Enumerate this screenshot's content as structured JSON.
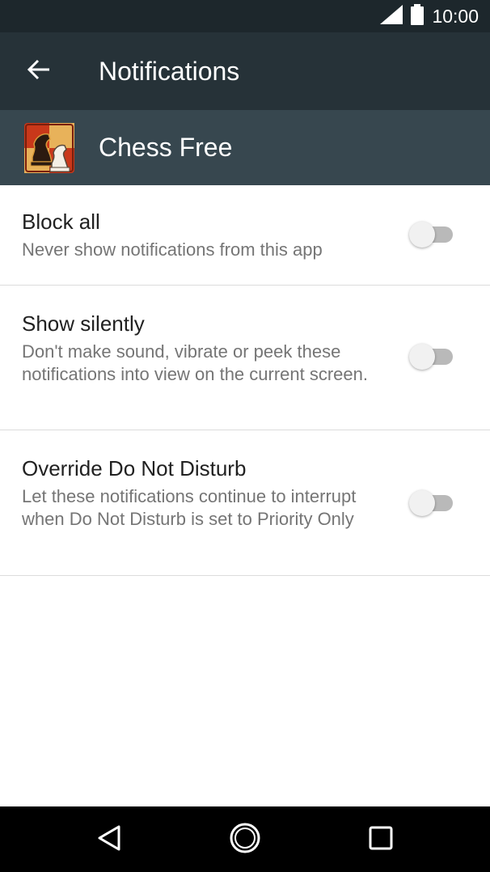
{
  "status_bar": {
    "time": "10:00",
    "signal_icon": "cell-signal-icon",
    "battery_icon": "battery-icon"
  },
  "app_bar": {
    "back_icon": "arrow-back-icon",
    "title": "Notifications"
  },
  "app_header": {
    "app_icon": "chess-knight-app-icon",
    "app_name": "Chess Free"
  },
  "settings": [
    {
      "title": "Block all",
      "summary": "Never show notifications from this app",
      "enabled": false
    },
    {
      "title": "Show silently",
      "summary": "Don't make sound, vibrate or peek these notifications into view on the current screen.",
      "enabled": false
    },
    {
      "title": "Override Do Not Disturb",
      "summary": "Let these notifications continue to interrupt when Do Not Disturb is set to Priority Only",
      "enabled": false
    }
  ],
  "nav_bar": {
    "back_icon": "nav-back-triangle-icon",
    "home_icon": "nav-home-circle-icon",
    "recents_icon": "nav-recents-square-icon"
  },
  "colors": {
    "status_bar": "#1d272c",
    "app_bar": "#263238",
    "app_header": "#37474f",
    "toggle_off_track": "#b9b9b9",
    "toggle_off_thumb": "#f1f1f1"
  }
}
